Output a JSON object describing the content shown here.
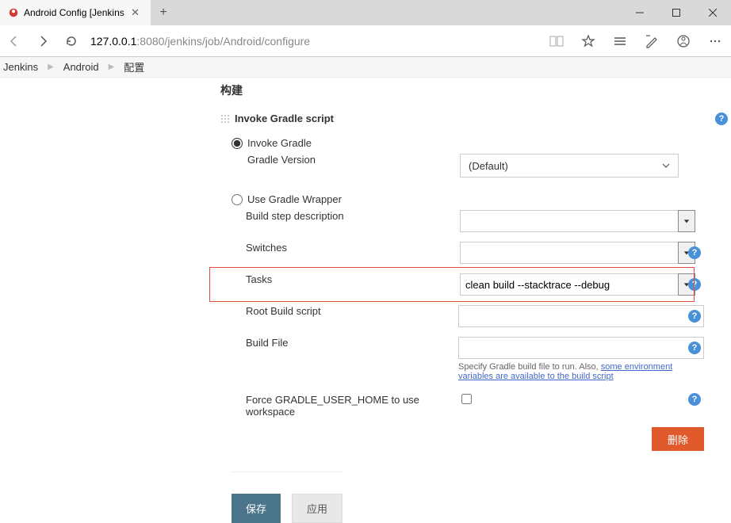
{
  "browser": {
    "tab_title": "Android Config [Jenkins",
    "url_host": "127.0.0.1",
    "url_rest": ":8080/jenkins/job/Android/configure"
  },
  "crumbs": {
    "c1": "Jenkins",
    "c2": "Android",
    "c3": "配置"
  },
  "section": {
    "title": "构建"
  },
  "step": {
    "title": "Invoke Gradle script",
    "radio_invoke": "Invoke Gradle",
    "gradle_version_label": "Gradle Version",
    "gradle_version_value": "(Default)",
    "radio_wrapper": "Use Gradle Wrapper",
    "desc_label": "Build step description",
    "desc_value": "",
    "switches_label": "Switches",
    "switches_value": "",
    "tasks_label": "Tasks",
    "tasks_value": "clean build --stacktrace --debug",
    "root_label": "Root Build script",
    "root_value": "",
    "buildfile_label": "Build File",
    "buildfile_value": "",
    "buildfile_hint_prefix": "Specify Gradle build file to run. Also, ",
    "buildfile_hint_link": "some environment variables are available to the build script",
    "force_home_label": "Force GRADLE_USER_HOME to use workspace",
    "delete_label": "删除"
  },
  "actions": {
    "save": "保存",
    "apply": "应用"
  }
}
